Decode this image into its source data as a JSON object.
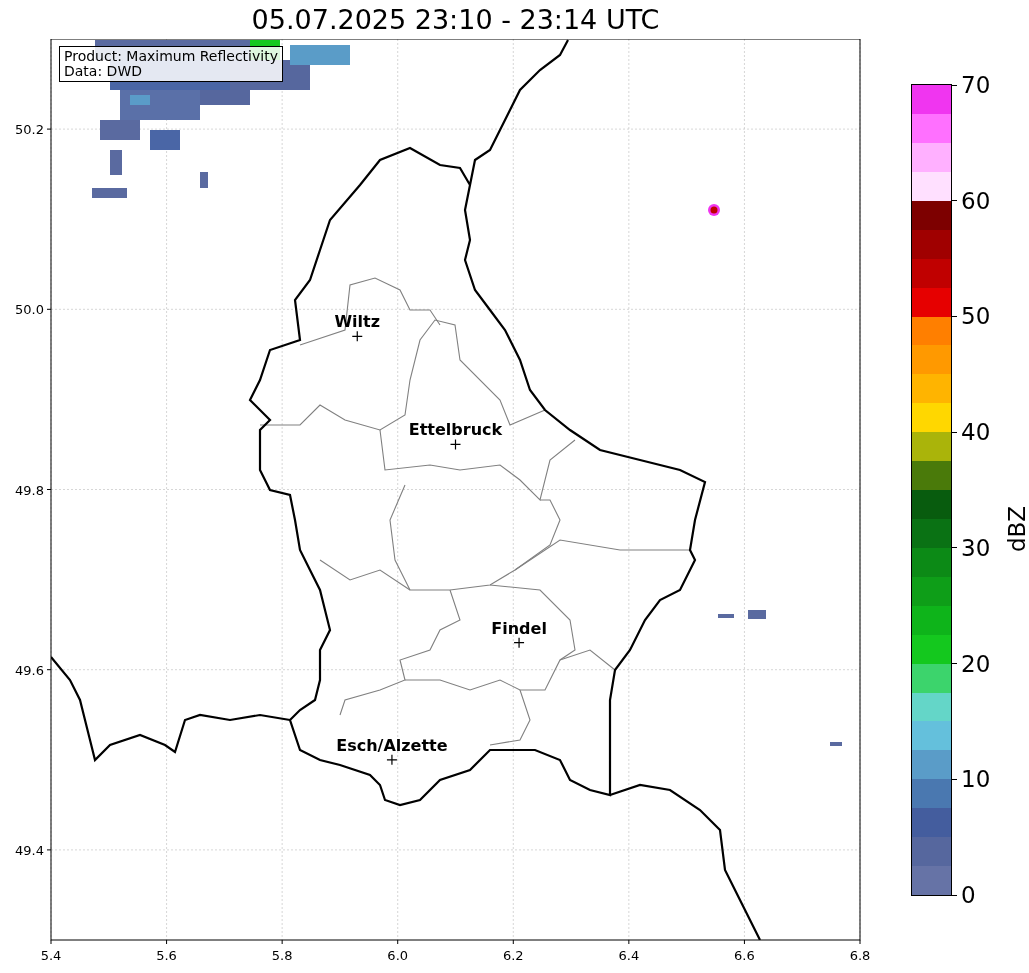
{
  "map": {
    "title": "05.07.2025 23:10 - 23:14 UTC",
    "x_ticks": [
      "5.4",
      "5.6",
      "5.8",
      "6.0",
      "6.2",
      "6.4",
      "6.6",
      "6.8"
    ],
    "y_ticks": [
      "50.2",
      "50.0",
      "49.8",
      "49.6",
      "49.4"
    ],
    "cities": [
      {
        "name": "Wiltz"
      },
      {
        "name": "Ettelbruck"
      },
      {
        "name": "Findel"
      },
      {
        "name": "Esch/Alzette"
      }
    ],
    "info_box": [
      "Product: Maximum Reflectivity",
      "Data: DWD"
    ]
  },
  "colorbar": {
    "label": "dBZ",
    "ticks": [
      "70",
      "60",
      "50",
      "40",
      "30",
      "20",
      "10",
      "0"
    ],
    "levels": [
      {
        "color": "#6673a6"
      },
      {
        "color": "#56679e"
      },
      {
        "color": "#445d9e"
      },
      {
        "color": "#4a78b0"
      },
      {
        "color": "#5a9cc8"
      },
      {
        "color": "#64c0dc"
      },
      {
        "color": "#64d6c8"
      },
      {
        "color": "#3cd46c"
      },
      {
        "color": "#14c81e"
      },
      {
        "color": "#0eb41a"
      },
      {
        "color": "#0e9e18"
      },
      {
        "color": "#0c8a16"
      },
      {
        "color": "#0a7214"
      },
      {
        "color": "#085c0e"
      },
      {
        "color": "#4a7a0a"
      },
      {
        "color": "#aab40a"
      },
      {
        "color": "#ffd700"
      },
      {
        "color": "#ffb400"
      },
      {
        "color": "#ff9900"
      },
      {
        "color": "#ff7f00"
      },
      {
        "color": "#e60000"
      },
      {
        "color": "#c00000"
      },
      {
        "color": "#a00000"
      },
      {
        "color": "#7d0000"
      },
      {
        "color": "#ffe0ff"
      },
      {
        "color": "#ffb0ff"
      },
      {
        "color": "#ff70ff"
      },
      {
        "color": "#f035f0"
      }
    ]
  }
}
